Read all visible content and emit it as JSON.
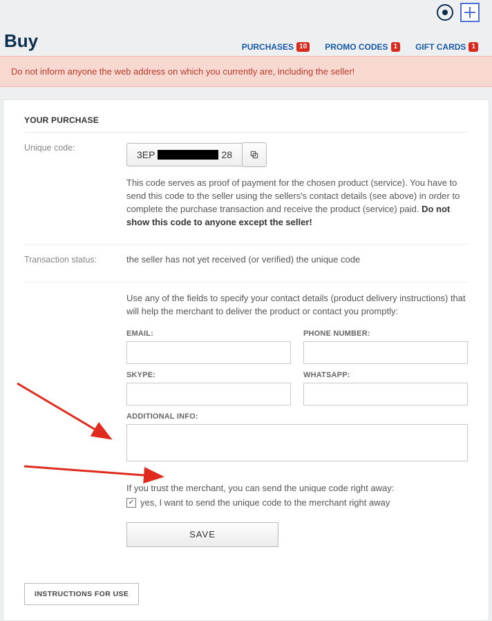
{
  "header": {
    "title": "Buy",
    "nav": {
      "purchases": {
        "label": "PURCHASES",
        "count": "10"
      },
      "promo": {
        "label": "PROMO CODES",
        "count": "1"
      },
      "gift": {
        "label": "GIFT CARDS",
        "count": "1"
      }
    }
  },
  "alert": "Do not inform anyone the web address on which you currently are, including the seller!",
  "purchase": {
    "section_title": "YOUR PURCHASE",
    "unique_code": {
      "label": "Unique code:",
      "prefix": "3EP",
      "suffix": "28",
      "desc_plain": "This code serves as proof of payment for the chosen product (service). You have to send this code to the seller using the sellers's contact details (see above) in order to complete the purchase transaction and receive the product (service) paid. ",
      "desc_bold": "Do not show this code to anyone except the seller!"
    },
    "status": {
      "label": "Transaction status:",
      "value": "the seller has not yet received (or verified) the unique code"
    },
    "contact": {
      "intro": "Use any of the fields to specify your contact details (product delivery instructions) that will help the merchant to deliver the product or contact you promptly:",
      "email_label": "EMAIL:",
      "phone_label": "PHONE NUMBER:",
      "skype_label": "SKYPE:",
      "whatsapp_label": "WHATSAPP:",
      "additional_label": "ADDITIONAL INFO:",
      "trust_line": "If you trust the merchant, you can send the unique code right away:",
      "chk_label": "yes, I want to send the unique code to the merchant right away",
      "chk_mark": "✓",
      "save_label": "SAVE"
    }
  },
  "instructions_btn": "INSTRUCTIONS FOR USE"
}
